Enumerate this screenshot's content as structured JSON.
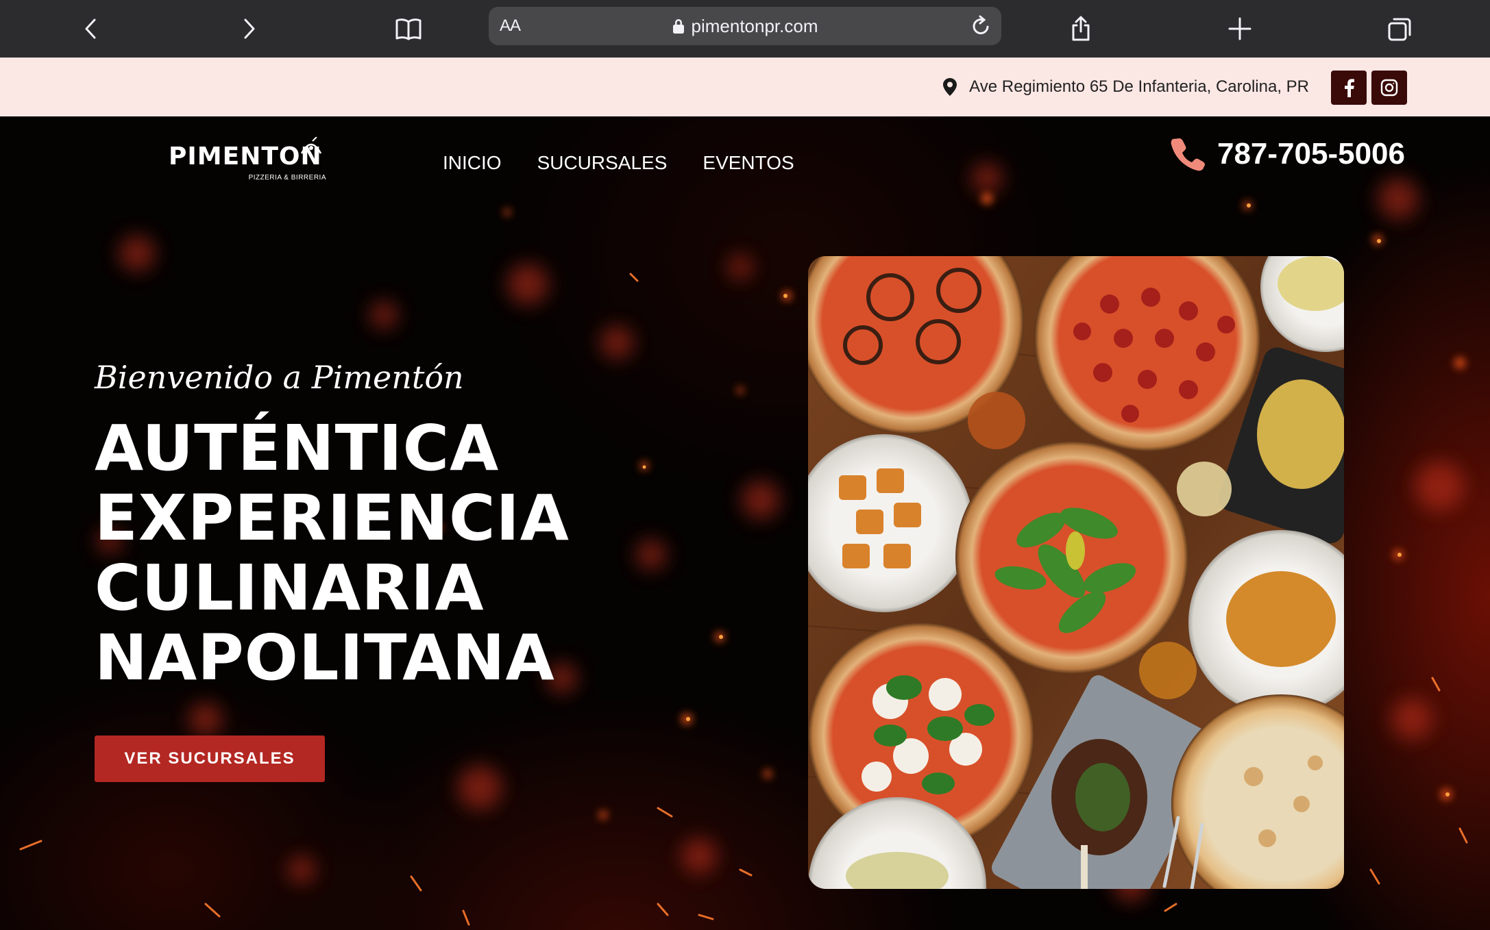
{
  "browser": {
    "reader_label": "AA",
    "url": "pimentonpr.com"
  },
  "topbar": {
    "address": "Ave Regimiento 65 De Infanteria, Carolina, PR"
  },
  "header": {
    "logo_text": "PIMENTON",
    "logo_subtext": "PIZZERIA & BIRRERIA",
    "nav": [
      "INICIO",
      "SUCURSALES",
      "EVENTOS"
    ],
    "phone": "787-705-5006"
  },
  "hero": {
    "tagline": "Bienvenido a Pimentón",
    "headline": [
      "AUTÉNTICA",
      "EXPERIENCIA",
      "CULINARIA",
      "NAPOLITANA"
    ],
    "cta_label": "VER SUCURSALES"
  },
  "colors": {
    "accent": "#b42823",
    "phone_icon": "#f08a7a",
    "info_strip": "#fbe7e4",
    "social_bg": "#3a0a08",
    "browser_bar": "#2c2c2e"
  },
  "icons": [
    "back-icon",
    "forward-icon",
    "book-icon",
    "lock-icon",
    "reload-icon",
    "share-icon",
    "plus-icon",
    "tabs-icon",
    "location-pin-icon",
    "facebook-icon",
    "instagram-icon",
    "phone-icon"
  ]
}
